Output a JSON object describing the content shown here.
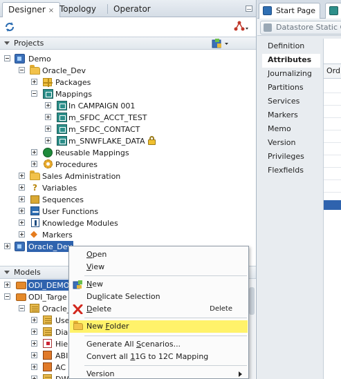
{
  "left_pane": {
    "tabs": [
      {
        "label": "Designer",
        "close": "×",
        "active": true
      },
      {
        "label": "Topology"
      },
      {
        "label": "Operator"
      }
    ],
    "projects_header": "Projects",
    "models_header": "Models",
    "tree": {
      "demo": "Demo",
      "oracle_dev_folder": "Oracle_Dev",
      "packages": "Packages",
      "mappings": "Mappings",
      "mapping_items": [
        "In CAMPAIGN 001",
        "m_SFDC_ACCT_TEST",
        "m_SFDC_CONTACT",
        "m_SNWFLAKE_DATA"
      ],
      "reusable_mappings": "Reusable Mappings",
      "procedures": "Procedures",
      "sales_admin": "Sales Administration",
      "variables": "Variables",
      "sequences": "Sequences",
      "user_functions": "User Functions",
      "knowledge_modules": "Knowledge Modules",
      "markers": "Markers",
      "oracle_dev_project": "Oracle_Dev"
    },
    "models_tree": {
      "odi_demo": "ODI_DEMO",
      "odi_target": "ODI_Targe",
      "oracle_sub": "Oracle_",
      "items": [
        "Use",
        "Dia",
        "Hie",
        "ABI",
        "AC",
        "DW"
      ]
    }
  },
  "context_menu": {
    "items": [
      {
        "label": "Open",
        "u": "O",
        "rest": "pen"
      },
      {
        "label": "View",
        "u": "V",
        "rest": "iew"
      },
      {
        "label": "New",
        "u": "N",
        "rest": "ew"
      },
      {
        "label": "Duplicate Selection",
        "pre": "Du",
        "u": "p",
        "rest": "licate Selection"
      },
      {
        "label": "Delete",
        "u": "D",
        "rest": "elete",
        "accelerator": "Delete"
      },
      {
        "label": "New Folder",
        "pre": "New ",
        "u": "F",
        "rest": "older"
      },
      {
        "label": "Generate All Scenarios...",
        "pre": "Generate All ",
        "u": "S",
        "rest": "cenarios..."
      },
      {
        "label": "Convert all 11G to 12C Mapping",
        "pre": "Convert all ",
        "u": "1",
        "rest": "1G to 12C Mapping"
      },
      {
        "label": "Version"
      }
    ]
  },
  "right_pane": {
    "tabs": [
      {
        "label": "Start Page"
      }
    ],
    "toolbar_button": "Datastore Static C",
    "nav_items": [
      "Definition",
      "Attributes",
      "Journalizing",
      "Partitions",
      "Services",
      "Markers",
      "Memo",
      "Version",
      "Privileges",
      "Flexfields"
    ],
    "active_nav": "Attributes",
    "grid_header": "Ord"
  },
  "colors": {
    "selection": "#2f63ae",
    "menu_highlight": "#fff26a",
    "folder": "#f2c24b"
  }
}
